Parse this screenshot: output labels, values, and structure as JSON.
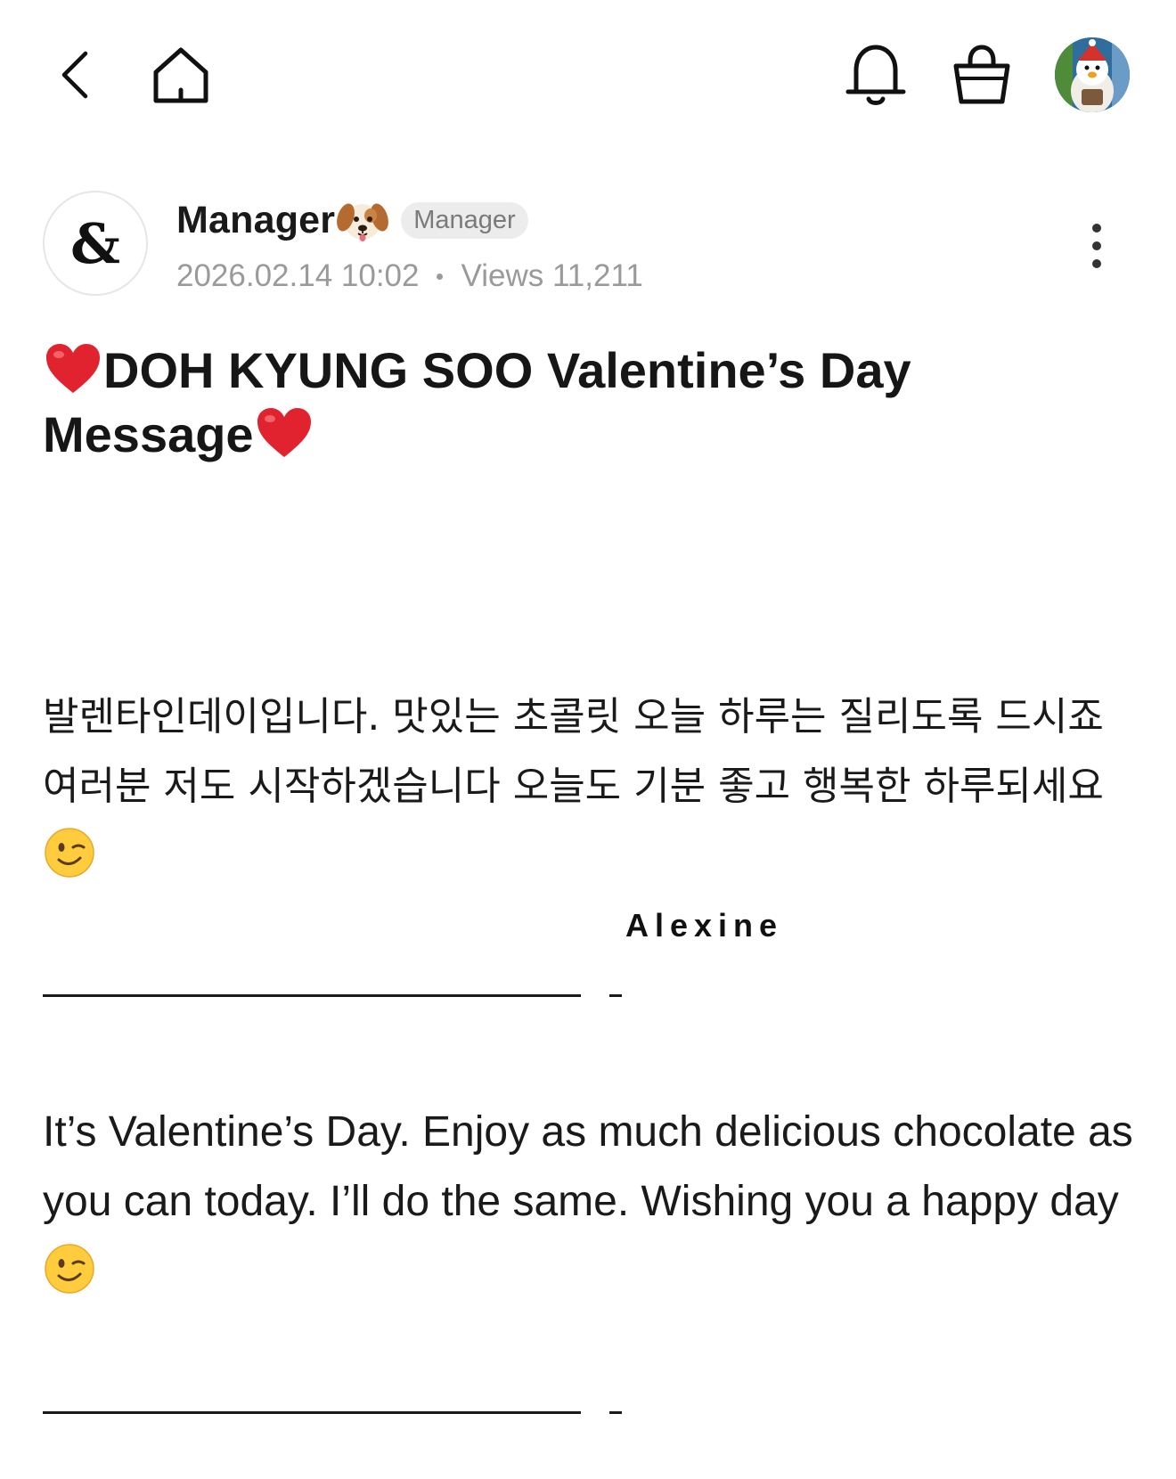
{
  "header": {
    "back_icon": "chevron-left-icon",
    "home_icon": "home-icon",
    "notification_icon": "bell-icon",
    "cart_icon": "shopping-bag-icon",
    "profile_avatar": "user-avatar"
  },
  "post": {
    "author": {
      "logo_text": "&",
      "name": "Manager",
      "name_emoji": "dog-face-emoji",
      "badge": "Manager"
    },
    "meta": {
      "datetime": "2026.02.14 10:02",
      "views": "Views 11,211"
    },
    "more_icon": "more-vertical-icon",
    "title": {
      "line1": "DOH KYUNG SOO Valentine’s Day",
      "line2": "Message",
      "emoji": "red-heart-emoji"
    },
    "body_ko": "발렌타인데이입니다. 맛있는 초콜릿 오늘 하루는 질리도록 드시죠 여러분 저도 시작하겠습니다 오늘도 기분 좋고 행복한 하루되세요",
    "signature": "Alexine",
    "divider": "—————————————————————-",
    "body_en": "It’s Valentine’s Day. Enjoy as much delicious chocolate as you can today. I’ll do the same. Wishing you a happy day",
    "body_emoji": "winking-face-emoji"
  },
  "colors": {
    "text": "#1a1a1a",
    "meta": "#9a9a9a",
    "badge_bg": "#ececec",
    "badge_text": "#7a7a7a",
    "heart": "#e0232e"
  }
}
